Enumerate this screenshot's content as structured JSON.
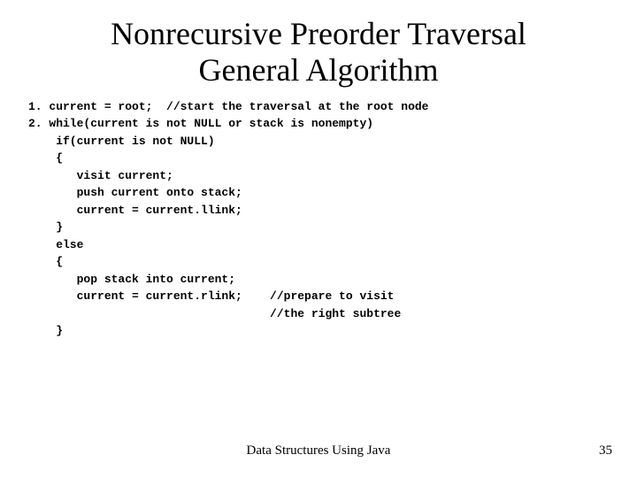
{
  "title_line1": "Nonrecursive Preorder Traversal",
  "title_line2": "General Algorithm",
  "code": "1. current = root;  //start the traversal at the root node\n2. while(current is not NULL or stack is nonempty)\n    if(current is not NULL)\n    {\n       visit current;\n       push current onto stack;\n       current = current.llink;\n    }\n    else\n    {\n       pop stack into current;\n       current = current.rlink;    //prepare to visit\n                                   //the right subtree\n    }",
  "footer_center": "Data Structures Using Java",
  "footer_right": "35"
}
